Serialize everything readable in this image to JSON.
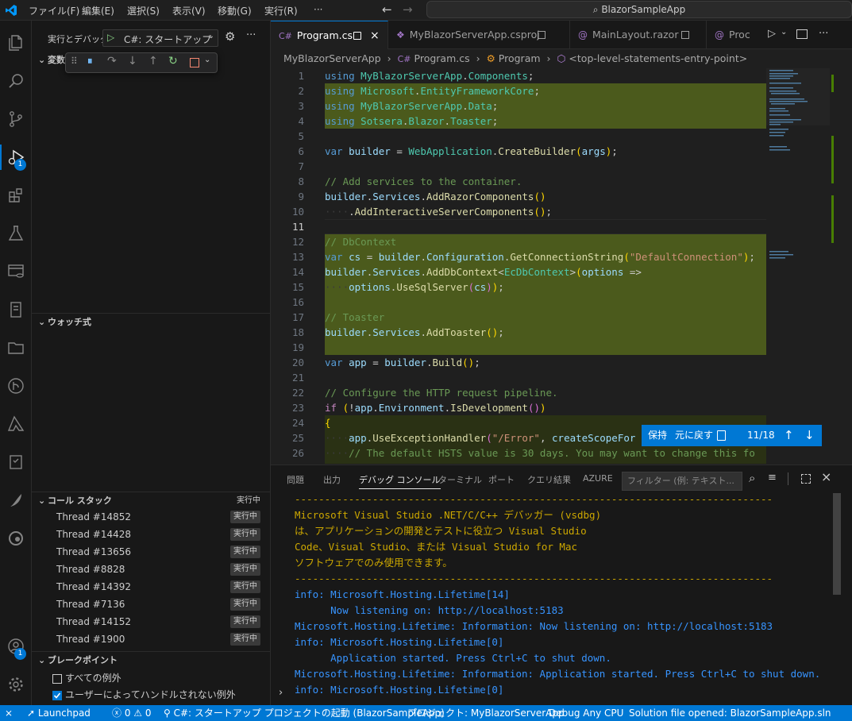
{
  "titlebar": {
    "menus": [
      "ファイル(F)",
      "編集(E)",
      "選択(S)",
      "表示(V)",
      "移動(G)",
      "実行(R)",
      "···"
    ],
    "search_text": "BlazorSampleApp"
  },
  "activity": {
    "debug_badge": "1",
    "account_badge": "1"
  },
  "sidebar": {
    "run_label": "実行とデバッグ",
    "config_selected": "C#: スタートアップ",
    "variables_title": "変数",
    "watch_title": "ウォッチ式",
    "callstack_title": "コール スタック",
    "callstack_status": "実行中",
    "threads": [
      {
        "name": "Thread #14852",
        "status": "実行中"
      },
      {
        "name": "Thread #14428",
        "status": "実行中"
      },
      {
        "name": "Thread #13656",
        "status": "実行中"
      },
      {
        "name": "Thread #8828",
        "status": "実行中"
      },
      {
        "name": "Thread #14392",
        "status": "実行中"
      },
      {
        "name": "Thread #7136",
        "status": "実行中"
      },
      {
        "name": "Thread #14152",
        "status": "実行中"
      },
      {
        "name": "Thread #1900",
        "status": "実行中"
      }
    ],
    "breakpoints_title": "ブレークポイント",
    "bp_all": "すべての例外",
    "bp_unhandled": "ユーザーによってハンドルされない例外"
  },
  "tabs": [
    {
      "icon": "C#",
      "label": "Program.cs",
      "active": true
    },
    {
      "icon": "proj",
      "label": "MyBlazorServerApp.csproj"
    },
    {
      "icon": "@",
      "label": "MainLayout.razor"
    },
    {
      "icon": "@",
      "label": "Proc"
    }
  ],
  "breadcrumb": {
    "project": "MyBlazorServerApp",
    "file_icon": "C#",
    "file": "Program.cs",
    "class": "Program",
    "member": "<top-level-statements-entry-point>"
  },
  "editor": {
    "line_numbers": [
      "1",
      "2",
      "3",
      "4",
      "5",
      "6",
      "7",
      "8",
      "9",
      "10",
      "11",
      "12",
      "13",
      "14",
      "15",
      "16",
      "17",
      "18",
      "19",
      "20",
      "21",
      "22",
      "23",
      "24",
      "25",
      "26"
    ],
    "current_line": "11"
  },
  "merge": {
    "keep": "保持",
    "undo": "元に戻す",
    "counter": "11/18"
  },
  "panel": {
    "tabs": [
      "問題",
      "出力",
      "デバッグ コンソール",
      "ターミナル",
      "ポート",
      "クエリ結果",
      "AZURE"
    ],
    "filter_placeholder": "フィルター (例: テキスト...",
    "console_lines": [
      {
        "kind": "dim",
        "text": "--------------------------------------------------------------------------------"
      },
      {
        "kind": "warn",
        "text": "Microsoft Visual Studio .NET/C/C++ デバッガー (vsdbg)"
      },
      {
        "kind": "warn",
        "text": "は、アプリケーションの開発とテストに役立つ Visual Studio"
      },
      {
        "kind": "warn",
        "text": "Code、Visual Studio、または Visual Studio for Mac"
      },
      {
        "kind": "warn",
        "text": "ソフトウェアでのみ使用できます。"
      },
      {
        "kind": "dim",
        "text": "--------------------------------------------------------------------------------"
      },
      {
        "kind": "info",
        "text": "info: Microsoft.Hosting.Lifetime[14]"
      },
      {
        "kind": "info",
        "text": "      Now listening on: http://localhost:5183"
      },
      {
        "kind": "info",
        "text": "Microsoft.Hosting.Lifetime: Information: Now listening on: http://localhost:5183"
      },
      {
        "kind": "info",
        "text": "info: Microsoft.Hosting.Lifetime[0]"
      },
      {
        "kind": "info",
        "text": "      Application started. Press Ctrl+C to shut down."
      },
      {
        "kind": "info",
        "text": "Microsoft.Hosting.Lifetime: Information: Application started. Press Ctrl+C to shut down."
      },
      {
        "kind": "info",
        "text": "info: Microsoft.Hosting.Lifetime[0]"
      }
    ]
  },
  "statusbar": {
    "launchpad": "Launchpad",
    "errors": "0",
    "warnings": "0",
    "debug_config": "C#: スタートアップ プロジェクトの起動 (BlazorSampleApp)",
    "project": "プロジェクト: MyBlazorServerApp",
    "config": "Debug Any CPU",
    "solution": "Solution file opened: BlazorSampleApp.sln"
  },
  "colors": {
    "accent": "#0078d4",
    "highlight": "#4b5a1c"
  }
}
